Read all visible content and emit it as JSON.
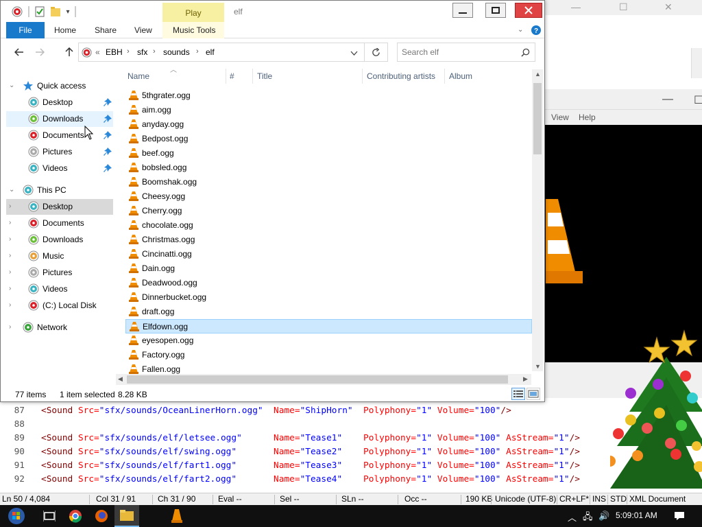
{
  "background_windows": {
    "vlc_menu": [
      "View",
      "Help"
    ]
  },
  "explorer": {
    "title": "elf",
    "contextual_tab": "Play",
    "ribbon_tabs": {
      "file": "File",
      "home": "Home",
      "share": "Share",
      "view": "View",
      "music_tools": "Music Tools"
    },
    "address": {
      "overflow": "«",
      "crumbs": [
        "EBH",
        "sfx",
        "sounds",
        "elf"
      ]
    },
    "search": {
      "placeholder": "Search elf"
    },
    "nav": {
      "quick_access": "Quick access",
      "quick_items": [
        "Desktop",
        "Downloads",
        "Documents",
        "Pictures",
        "Videos"
      ],
      "this_pc": "This PC",
      "pc_items": [
        "Desktop",
        "Documents",
        "Downloads",
        "Music",
        "Pictures",
        "Videos",
        "(C:) Local Disk"
      ],
      "network": "Network"
    },
    "columns": {
      "name": "Name",
      "number": "#",
      "title": "Title",
      "artists": "Contributing artists",
      "album": "Album"
    },
    "files": [
      "5thgrater.ogg",
      "aim.ogg",
      "anyday.ogg",
      "Bedpost.ogg",
      "beef.ogg",
      "bobsled.ogg",
      "Boomshak.ogg",
      "Cheesy.ogg",
      "Cherry.ogg",
      "chocolate.ogg",
      "Christmas.ogg",
      "Cincinatti.ogg",
      "Dain.ogg",
      "Deadwood.ogg",
      "Dinnerbucket.ogg",
      "draft.ogg",
      "Elfdown.ogg",
      "eyesopen.ogg",
      "Factory.ogg",
      "Fallen.ogg"
    ],
    "selected_file_index": 16,
    "status": {
      "items": "77 items",
      "selected": "1 item selected",
      "size": "8.28 KB"
    }
  },
  "editor": {
    "lines": [
      {
        "num": "87",
        "src": "sfx/sounds/OceanLinerHorn.ogg",
        "pad1": "  ",
        "name": "ShipHorn",
        "pad2": " ",
        "poly": "1",
        "vol": "100",
        "stream": null,
        "close": "/>"
      },
      {
        "num": "88"
      },
      {
        "num": "89",
        "src": "sfx/sounds/elf/letsee.ogg",
        "pad1": "      ",
        "name": "Tease1",
        "pad2": "   ",
        "poly": "1",
        "vol": "100",
        "stream": "1",
        "close": "/>"
      },
      {
        "num": "90",
        "src": "sfx/sounds/elf/swing.ogg",
        "pad1": "       ",
        "name": "Tease2",
        "pad2": "   ",
        "poly": "1",
        "vol": "100",
        "stream": "1",
        "close": "/>"
      },
      {
        "num": "91",
        "src": "sfx/sounds/elf/fart1.ogg",
        "pad1": "       ",
        "name": "Tease3",
        "pad2": "   ",
        "poly": "1",
        "vol": "100",
        "stream": "1",
        "close": "/>"
      },
      {
        "num": "92",
        "src": "sfx/sounds/elf/fart2.ogg",
        "pad1": "       ",
        "name": "Tease4",
        "pad2": "   ",
        "poly": "1",
        "vol": "100",
        "stream": "1",
        "close": "/>"
      }
    ],
    "tokens": {
      "tag": "<Sound",
      "src_attr": "Src=",
      "name_attr": "Name=",
      "poly_attr": "Polyphony=",
      "vol_attr": "Volume=",
      "stream_attr": "AsStream="
    },
    "status": {
      "ln": "Ln  50 / 4,084",
      "col": "Col  31 / 91",
      "ch": "Ch  31 / 90",
      "eval": "Eval  --",
      "sel": "Sel  --",
      "sln": "SLn  --",
      "occ": "Occ  --",
      "size": "190 KB",
      "encoding": "Unicode (UTF-8)",
      "eol": "CR+LF*",
      "ins": "INS",
      "std": "STD",
      "doctype": "XML Document"
    }
  },
  "taskbar": {
    "clock": "5:09:01 AM"
  },
  "colors": {
    "accent": "#1979ca",
    "selection": "#cce8ff",
    "selection_border": "#99d1ff",
    "contextual_tab": "#f7f0a2",
    "close_button": "#e04343",
    "vlc_orange": "#f08c00"
  },
  "icons": {
    "file": "vlc-cone-icon",
    "quick_access": "star-icon",
    "pin": "pin-icon",
    "back": "back-arrow-icon",
    "forward": "forward-arrow-icon",
    "up": "up-arrow-icon",
    "refresh": "refresh-icon",
    "search": "search-icon",
    "help": "help-icon"
  }
}
